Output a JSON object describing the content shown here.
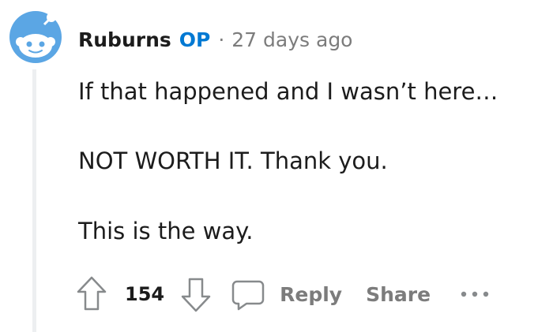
{
  "comment": {
    "username": "Ruburns",
    "op_badge": "OP",
    "separator": "·",
    "timestamp": "27 days ago",
    "avatar_icon": "reddit-snoo-avatar-icon",
    "body": [
      "If that happened and I wasn’t here…",
      "NOT WORTH IT. Thank you.",
      "This is the way."
    ],
    "score": "154",
    "actions": {
      "upvote_icon": "arrow-up-icon",
      "downvote_icon": "arrow-down-icon",
      "reply_icon": "speech-bubble-icon",
      "reply_label": "Reply",
      "share_label": "Share",
      "more_icon": "ellipsis-icon"
    }
  },
  "colors": {
    "op_accent": "#0079d3",
    "avatar_blue": "#5ba6e4",
    "meta_gray": "#7c7c7c",
    "thread_line": "#edeff1",
    "text": "#1c1c1c"
  }
}
